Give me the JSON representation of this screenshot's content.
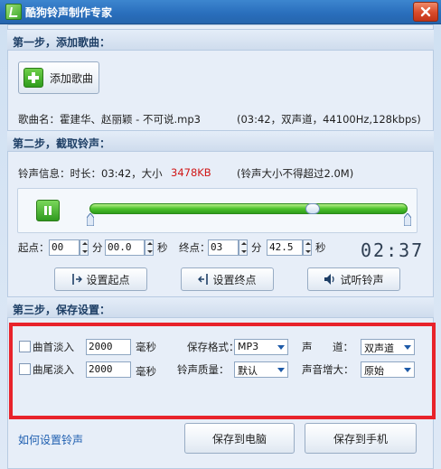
{
  "window": {
    "title": "酷狗铃声制作专家"
  },
  "step1": {
    "header": "第一步，添加歌曲：",
    "add_button": "添加歌曲",
    "song_name": "歌曲名：霍建华、赵丽颖 - 不可说.mp3",
    "song_info": "(03:42，双声道，44100Hz,128kbps)"
  },
  "step2": {
    "header": "第二步，截取铃声：",
    "info_prefix": "铃声信息：时长：03:42，大小",
    "size": "3478KB",
    "size_note": "(铃声大小不得超过2.0M)",
    "start_label": "起点：",
    "start_min": "00",
    "start_sec": "00.0",
    "end_label": "终点：",
    "end_min": "03",
    "end_sec": "42.5",
    "min_unit": "分",
    "sec_unit": "秒",
    "timer": "02:37",
    "set_start": "设置起点",
    "set_end": "设置终点",
    "preview": "试听铃声"
  },
  "step3": {
    "header": "第三步，保存设置：",
    "fade_in": {
      "label": "曲首淡入",
      "value": "2000",
      "unit": "毫秒"
    },
    "fade_out": {
      "label": "曲尾淡入",
      "value": "2000",
      "unit": "毫秒"
    },
    "format_label": "保存格式：",
    "format_value": "MP3",
    "quality_label": "铃声质量：",
    "quality_value": "默认",
    "channel_label": "声",
    "channel_label2": "道：",
    "channel_value": "双声道",
    "gain_label": "声音增大：",
    "gain_value": "原始"
  },
  "footer": {
    "help_link": "如何设置铃声",
    "save_pc": "保存到电脑",
    "save_phone": "保存到手机"
  },
  "colors": {
    "accent": "#2a6fbd",
    "highlight": "#e8232b",
    "size_text": "#d01818"
  }
}
